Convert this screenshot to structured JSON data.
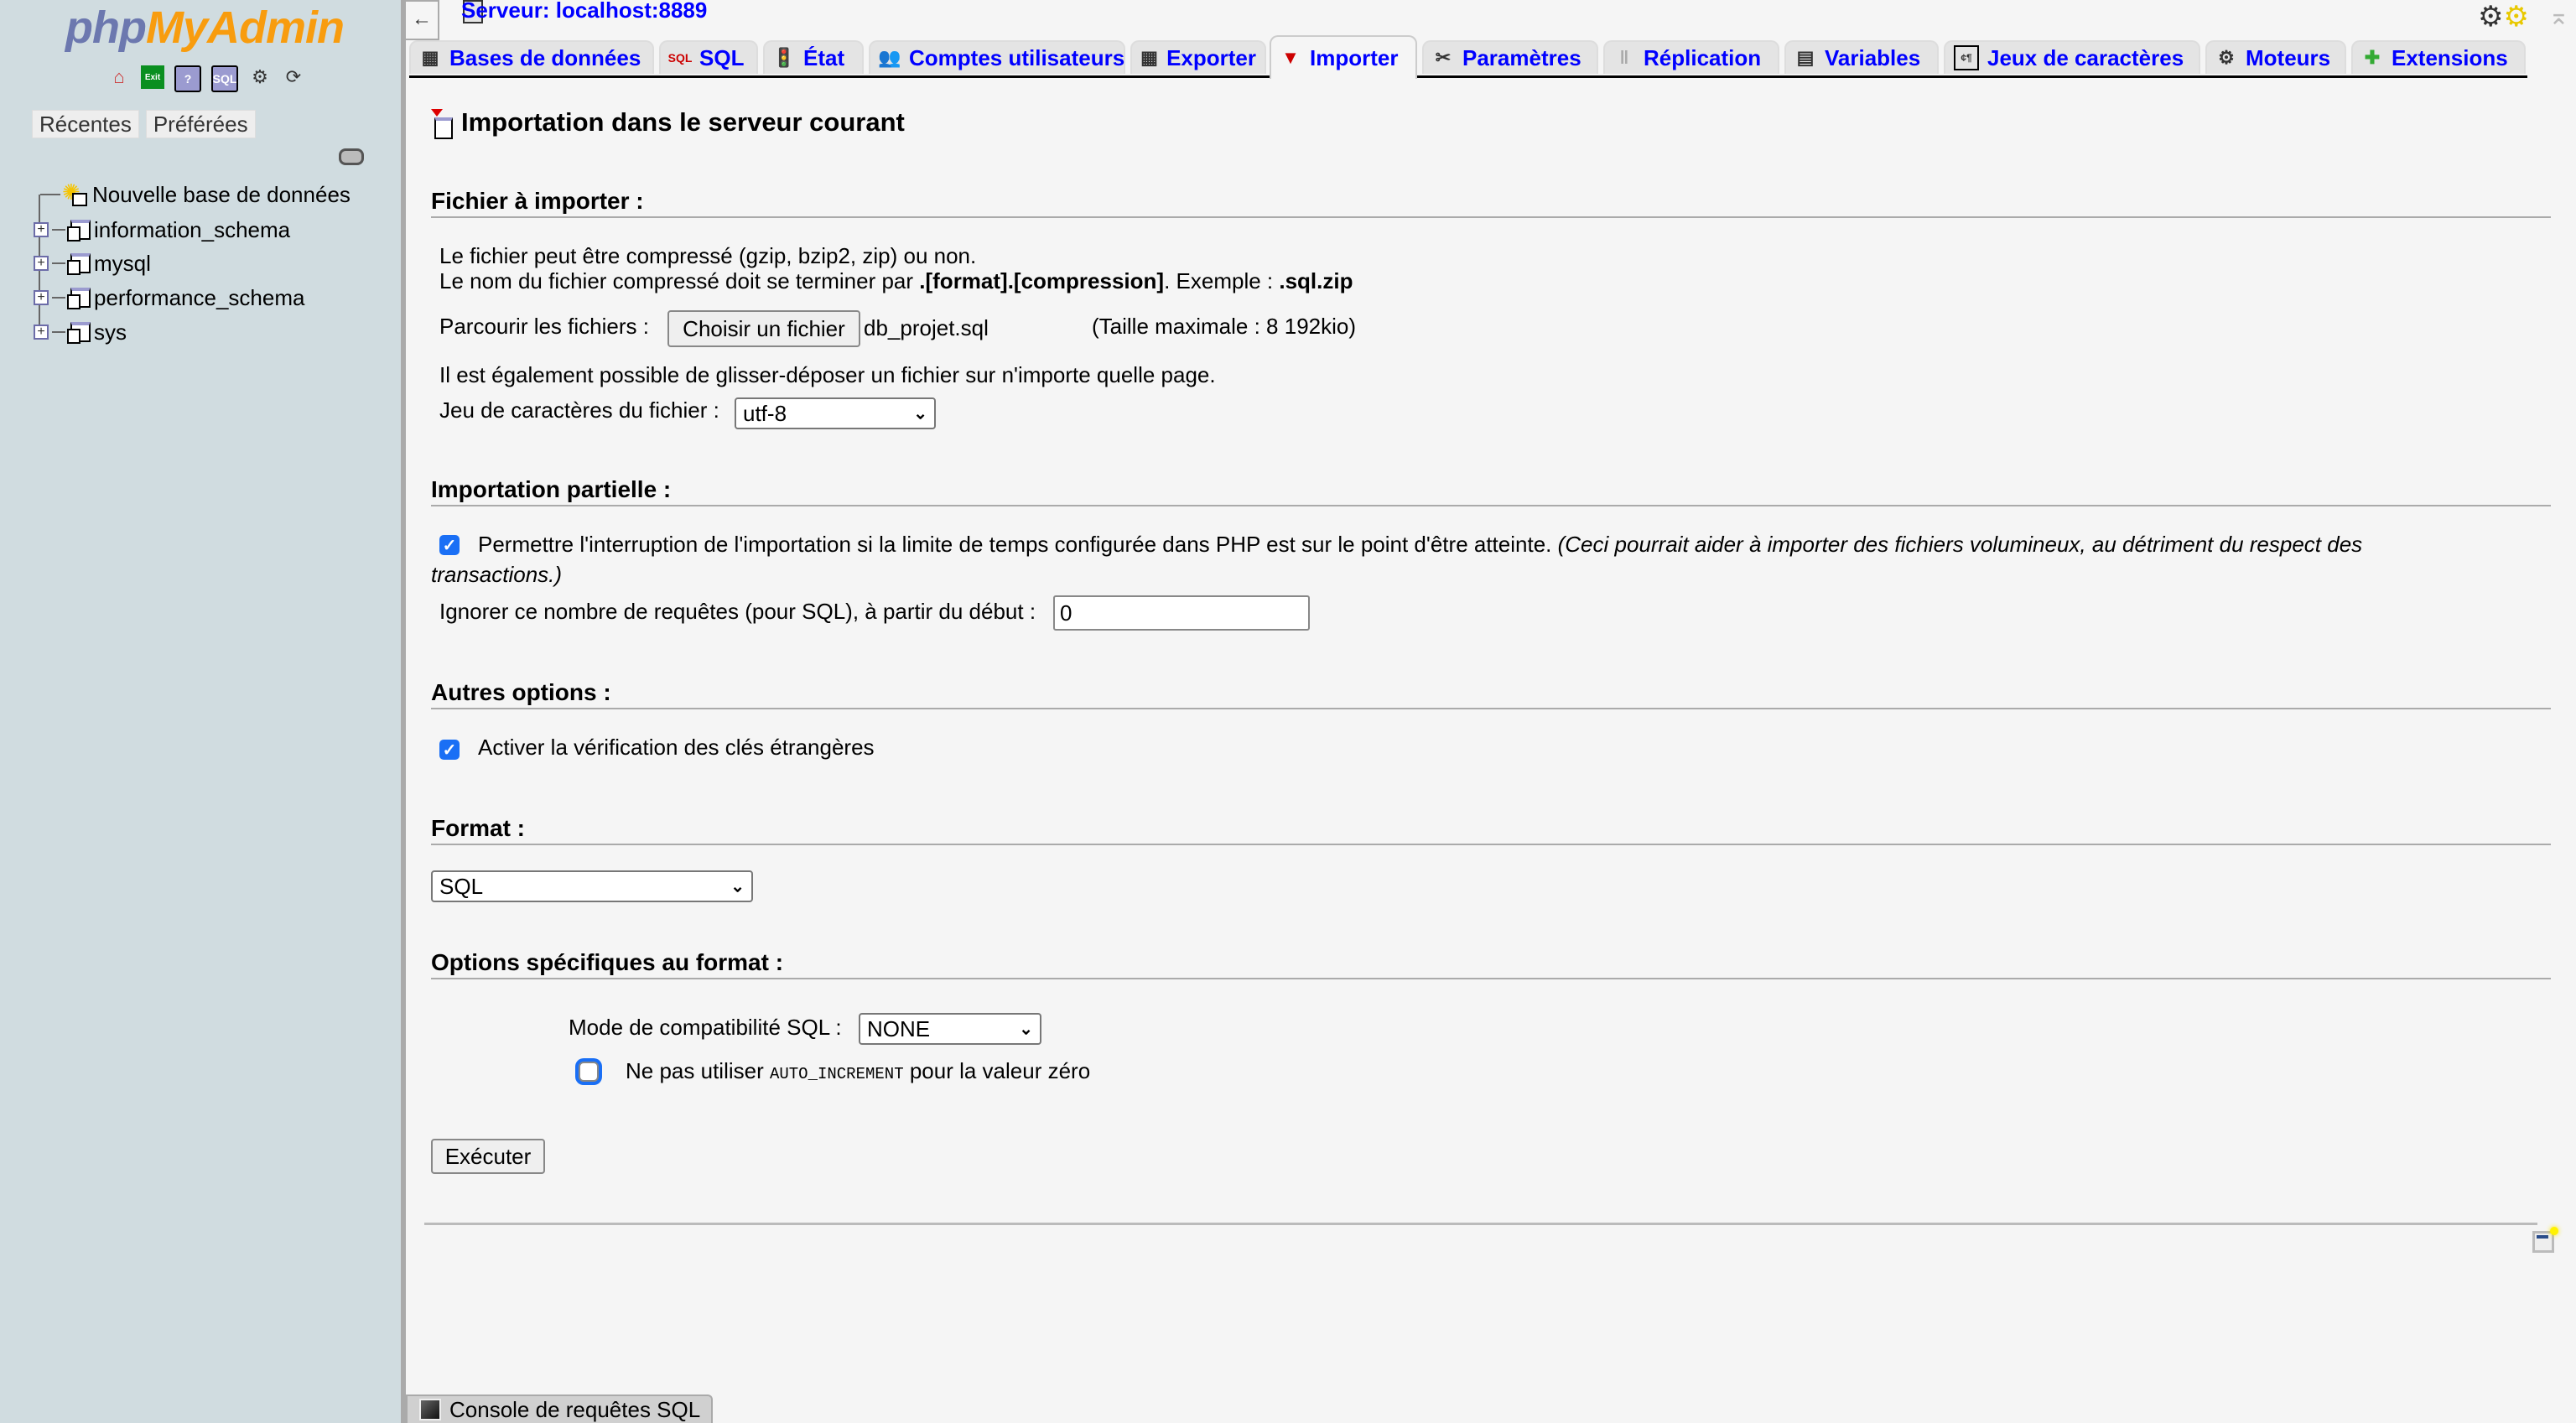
{
  "sidebar": {
    "logo_php": "php",
    "logo_myadmin": "MyAdmin",
    "nav_icons": [
      "home-icon",
      "exit-icon",
      "help-icon",
      "sql-query-icon",
      "settings-gear-icon",
      "reload-icon"
    ],
    "exit_label": "Exit",
    "help_label": "?",
    "sql_label": "SQL",
    "tabs": [
      "Récentes",
      "Préférées"
    ],
    "tree": {
      "new_db": "Nouvelle base de données",
      "databases": [
        "information_schema",
        "mysql",
        "performance_schema",
        "sys"
      ]
    }
  },
  "header": {
    "back_label": "←",
    "server_label": "Serveur: localhost:8889"
  },
  "tabs": [
    {
      "label": "Bases de données",
      "icon": "databases-icon",
      "active": false
    },
    {
      "label": "SQL",
      "icon": "sql-icon",
      "active": false
    },
    {
      "label": "État",
      "icon": "status-traffic-light-icon",
      "active": false
    },
    {
      "label": "Comptes utilisateurs",
      "icon": "user-accounts-icon",
      "active": false
    },
    {
      "label": "Exporter",
      "icon": "export-icon",
      "active": false
    },
    {
      "label": "Importer",
      "icon": "import-icon",
      "active": true
    },
    {
      "label": "Paramètres",
      "icon": "settings-tools-icon",
      "active": false
    },
    {
      "label": "Réplication",
      "icon": "replication-icon",
      "active": false
    },
    {
      "label": "Variables",
      "icon": "variables-icon",
      "active": false
    },
    {
      "label": "Jeux de caractères",
      "icon": "charset-icon",
      "active": false
    },
    {
      "label": "Moteurs",
      "icon": "engines-icon",
      "active": false
    },
    {
      "label": "Extensions",
      "icon": "extensions-puzzle-icon",
      "active": false
    }
  ],
  "page": {
    "title": "Importation dans le serveur courant",
    "file_section": {
      "legend": "Fichier à importer :",
      "line1": "Le fichier peut être compressé (gzip, bzip2, zip) ou non.",
      "line2_prefix": "Le nom du fichier compressé doit se terminer par ",
      "line2_bold": ".[format].[compression]",
      "line2_mid": ". Exemple : ",
      "line2_example": ".sql.zip",
      "browse_label": "Parcourir les fichiers :",
      "choose_button": "Choisir un fichier",
      "chosen_file": "db_projet.sql",
      "max_size": "(Taille maximale : 8 192kio)",
      "drag_note": "Il est également possible de glisser-déposer un fichier sur n'importe quelle page.",
      "charset_label": "Jeu de caractères du fichier :",
      "charset_value": "utf-8"
    },
    "partial_section": {
      "legend": "Importation partielle :",
      "allow_interrupt_checked": true,
      "allow_interrupt_label": "Permettre l'interruption de l'importation si la limite de temps configurée dans PHP est sur le point d'être atteinte.",
      "allow_interrupt_note_1": "(Ceci pourrait aider à importer des fichiers volumineux, au détriment du respect des",
      "allow_interrupt_note_2": "transactions.)",
      "skip_label": "Ignorer ce nombre de requêtes (pour SQL), à partir du début :",
      "skip_value": "0"
    },
    "other_section": {
      "legend": "Autres options :",
      "fk_checked": true,
      "fk_label": "Activer la vérification des clés étrangères"
    },
    "format_section": {
      "legend": "Format :",
      "format_value": "SQL"
    },
    "format_options": {
      "legend": "Options spécifiques au format :",
      "compat_label": "Mode de compatibilité SQL :",
      "compat_value": "NONE",
      "no_auto_inc_checked": false,
      "no_auto_inc_prefix": "Ne pas utiliser ",
      "no_auto_inc_code": "AUTO_INCREMENT",
      "no_auto_inc_suffix": " pour la valeur zéro"
    },
    "submit_label": "Exécuter"
  },
  "console": {
    "label": "Console de requêtes SQL"
  }
}
